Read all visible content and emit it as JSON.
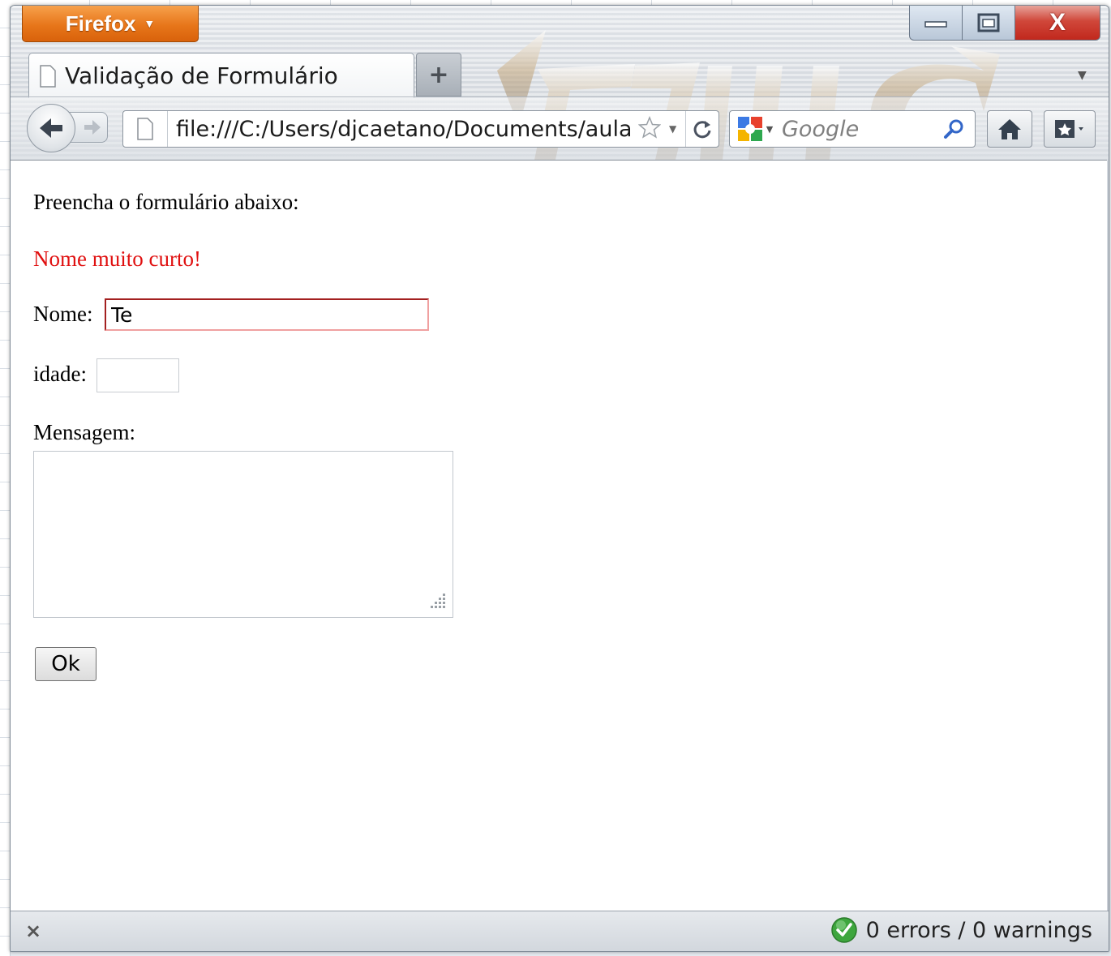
{
  "browser": {
    "menu_button": "Firefox",
    "tab_title": "Validação de Formulário",
    "new_tab": "+",
    "url": "file:///C:/Users/djcaetano/Documents/aulas/",
    "search_placeholder": "Google",
    "controls": {
      "close": "X"
    }
  },
  "page": {
    "intro": "Preencha o formulário abaixo:",
    "error": "Nome muito curto!",
    "nome_label": "Nome:",
    "nome_value": "Te",
    "idade_label": "idade:",
    "idade_value": "",
    "mensagem_label": "Mensagem:",
    "mensagem_value": "",
    "ok_button": "Ok",
    "error_color": "#e01010"
  },
  "statusbar": {
    "close": "×",
    "validator": "0 errors / 0 warnings"
  }
}
